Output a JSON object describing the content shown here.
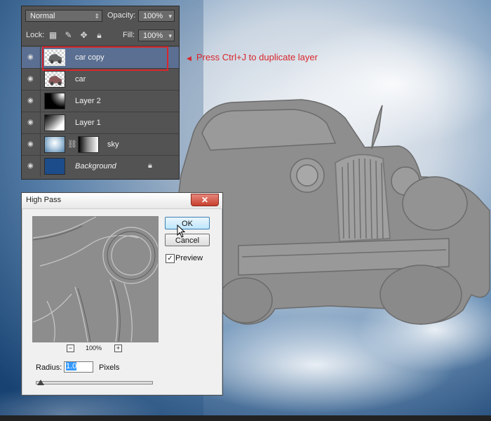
{
  "layers_panel": {
    "blend_mode": "Normal",
    "opacity_label": "Opacity:",
    "opacity_value": "100%",
    "lock_label": "Lock:",
    "fill_label": "Fill:",
    "fill_value": "100%",
    "layers": [
      {
        "name": "car copy",
        "selected": true,
        "thumb": "car-transparent"
      },
      {
        "name": "car",
        "selected": false,
        "thumb": "car-transparent"
      },
      {
        "name": "Layer 2",
        "selected": false,
        "thumb": "black-gradient"
      },
      {
        "name": "Layer 1",
        "selected": false,
        "thumb": "white-gradient"
      },
      {
        "name": "sky",
        "selected": false,
        "thumb": "sky-with-mask"
      },
      {
        "name": "Background",
        "selected": false,
        "thumb": "blue-fill",
        "locked": true
      }
    ]
  },
  "callout": {
    "text": "Press Ctrl+J to duplicate layer",
    "color": "#d8262c"
  },
  "dialog": {
    "title": "High Pass",
    "close_glyph": "✕",
    "ok_label": "OK",
    "cancel_label": "Cancel",
    "preview_label": "Preview",
    "preview_checked": true,
    "zoom_value": "100%",
    "zoom_out_glyph": "−",
    "zoom_in_glyph": "+",
    "radius_label": "Radius:",
    "radius_value": "1.0",
    "pixels_label": "Pixels"
  },
  "colors": {
    "panel_bg": "#535353",
    "selected_row": "#5b6f93",
    "highlight": "#d8262c"
  }
}
